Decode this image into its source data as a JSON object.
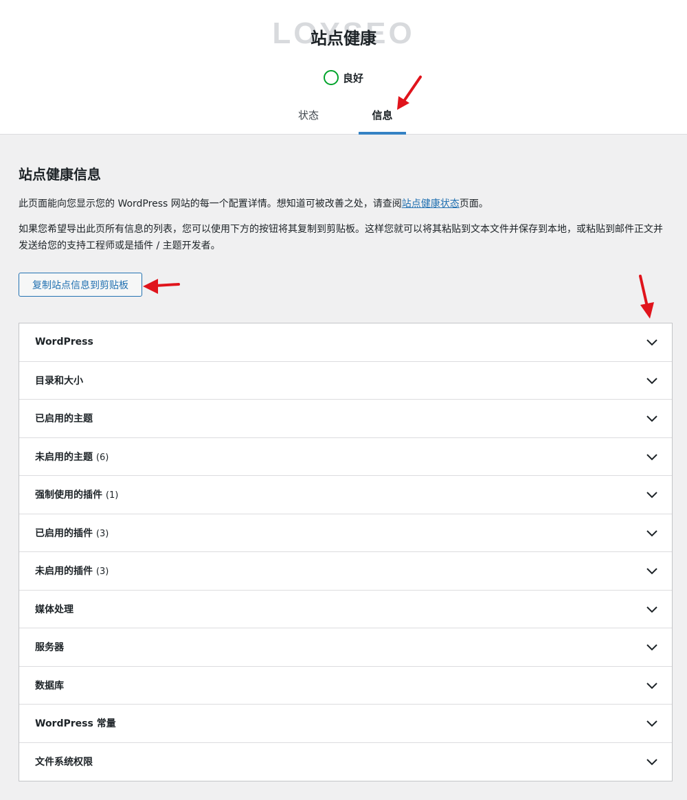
{
  "header": {
    "watermark": "LOYSEO",
    "title": "站点健康",
    "status": "良好",
    "tabs": [
      {
        "label": "状态"
      },
      {
        "label": "信息"
      }
    ]
  },
  "main": {
    "section_title": "站点健康信息",
    "p1_before": "此页面能向您显示您的 WordPress 网站的每一个配置详情。想知道可被改善之处，请查阅",
    "p1_link": "站点健康状态",
    "p1_after": "页面。",
    "p2": "如果您希望导出此页所有信息的列表，您可以使用下方的按钮将其复制到剪贴板。这样您就可以将其粘贴到文本文件并保存到本地，或粘贴到邮件正文并发送给您的支持工程师或是插件 / 主题开发者。",
    "copy_button": "复制站点信息到剪贴板"
  },
  "accordion": [
    {
      "label": "WordPress",
      "count": ""
    },
    {
      "label": "目录和大小",
      "count": ""
    },
    {
      "label": "已启用的主题",
      "count": ""
    },
    {
      "label": "未启用的主题",
      "count": "(6)"
    },
    {
      "label": "强制使用的插件",
      "count": "(1)"
    },
    {
      "label": "已启用的插件",
      "count": "(3)"
    },
    {
      "label": "未启用的插件",
      "count": "(3)"
    },
    {
      "label": "媒体处理",
      "count": ""
    },
    {
      "label": "服务器",
      "count": ""
    },
    {
      "label": "数据库",
      "count": ""
    },
    {
      "label": "WordPress 常量",
      "count": ""
    },
    {
      "label": "文件系统权限",
      "count": ""
    }
  ],
  "colors": {
    "accent": "#2271b1",
    "tab_active": "#3582c4",
    "good": "#00a32a",
    "annotation": "#e0141c"
  }
}
